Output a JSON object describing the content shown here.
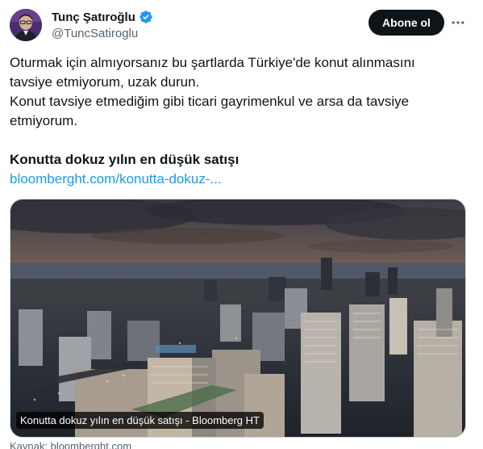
{
  "author": {
    "display_name": "Tunç Şatıroğlu",
    "handle": "@TuncSatiroglu",
    "avatar_icon": "person-avatar-icon",
    "verified_icon": "verified-badge-icon"
  },
  "actions": {
    "follow_label": "Abone ol",
    "more_icon": "more-dots-icon"
  },
  "tweet": {
    "lines": [
      "Oturmak için almıyorsanız bu şartlarda Türkiye'de konut alınmasını tavsiye etmiyorum, uzak durun.",
      "Konut tavsiye etmediğim gibi ticari gayrimenkul ve arsa da tavsiye etmiyorum."
    ]
  },
  "card": {
    "title": "Konutta dokuz yılın en düşük satışı",
    "link_text": "bloomberght.com/konutta-dokuz-...",
    "image_caption": "Konutta dokuz yılın en düşük satışı - Bloomberg HT",
    "source": "Kaynak: bloomberght.com"
  },
  "colors": {
    "text_primary": "#0f1419",
    "text_secondary": "#536471",
    "link": "#1d9bf0",
    "verified": "#1d9bf0",
    "button_bg": "#0f1419"
  }
}
